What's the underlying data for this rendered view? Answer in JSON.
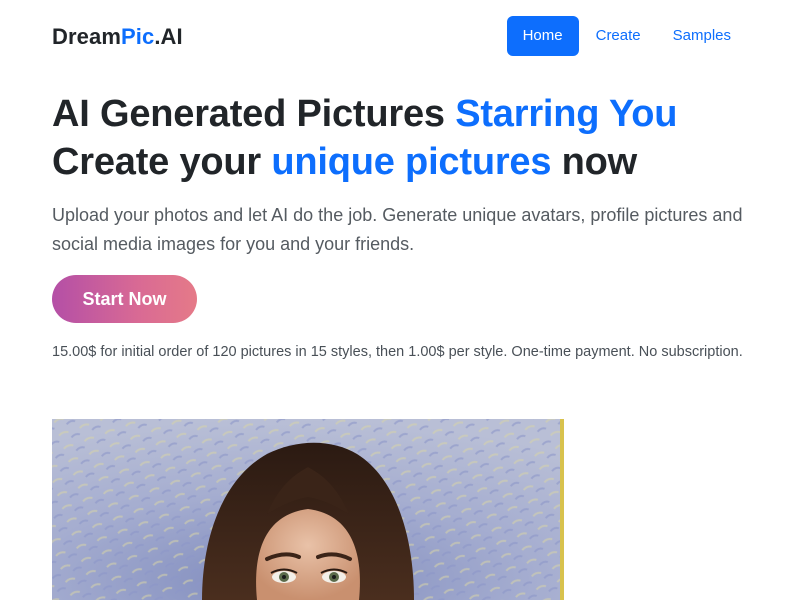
{
  "brand": {
    "part1": "Dream",
    "part2": "Pic",
    "part3": ".AI"
  },
  "nav": {
    "items": [
      {
        "label": "Home",
        "active": true
      },
      {
        "label": "Create",
        "active": false
      },
      {
        "label": "Samples",
        "active": false
      }
    ]
  },
  "hero": {
    "title_line1_plain": "AI Generated Pictures ",
    "title_line1_highlight": "Starring You",
    "title_line2_plain_a": "Create your ",
    "title_line2_highlight": "unique pictures",
    "title_line2_plain_b": " now",
    "lead": "Upload your photos and let AI do the job. Generate unique avatars, profile pictures and social media images for you and your friends.",
    "cta_label": "Start Now",
    "price_note": "15.00$ for initial order of 120 pictures in 15 styles, then 1.00$ per style. One-time payment. No subscription."
  },
  "colors": {
    "accent": "#0d6efd",
    "cta_gradient_start": "#b44fa6",
    "cta_gradient_end": "#e57a88"
  }
}
